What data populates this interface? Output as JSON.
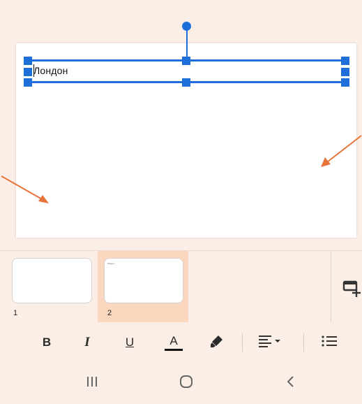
{
  "slide": {
    "text_box": {
      "text": "Лондон"
    }
  },
  "thumbnails": [
    {
      "number": "1",
      "preview_text": ""
    },
    {
      "number": "2",
      "preview_text": "Лондон"
    }
  ],
  "toolbar": {
    "bold": "B",
    "italic": "I",
    "underline": "U",
    "font_color": "A"
  },
  "icons": {
    "add_slide": "add-slide-icon",
    "highlighter": "highlighter-icon",
    "align": "align-left-dropdown-icon",
    "list": "bulleted-list-icon",
    "nav_recents": "recents-icon",
    "nav_home": "home-icon",
    "nav_back": "back-icon"
  },
  "colors": {
    "selection": "#1e6fd9",
    "annotation_arrow": "#e8733a",
    "active_thumb_bg": "#fbd7c0",
    "background": "#fbeee6"
  }
}
